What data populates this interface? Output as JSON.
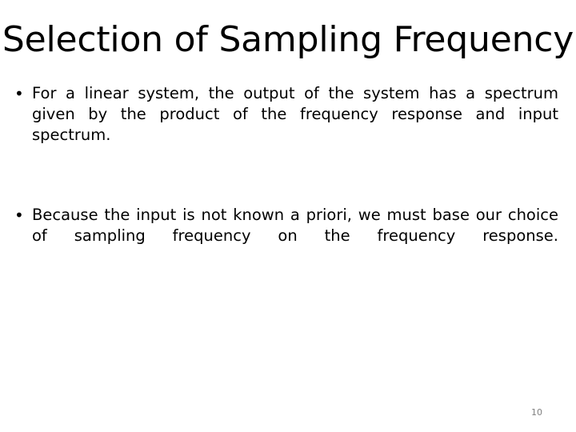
{
  "slide": {
    "title": "Selection of Sampling Frequency",
    "page_number": "10",
    "bullet_marker": "•",
    "bullets": [
      {
        "text": "For a linear system, the output of the system has a spectrum given by the product of the frequency response and input spectrum."
      },
      {
        "text": "Because the input is not known a priori, we must base our choice of sampling frequency on the frequency response."
      }
    ],
    "colors": {
      "background": "#ffffff",
      "text": "#000000",
      "page_number": "#808080"
    }
  }
}
